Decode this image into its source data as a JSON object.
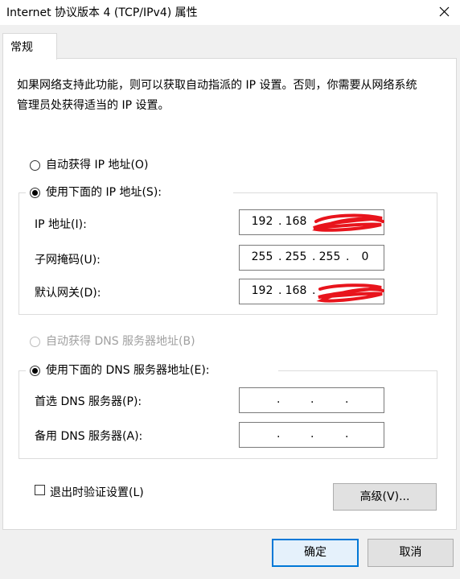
{
  "window": {
    "title": "Internet 协议版本 4 (TCP/IPv4) 属性",
    "close_glyph": "✕"
  },
  "tabs": [
    {
      "label": "常规"
    }
  ],
  "description": "如果网络支持此功能，则可以获取自动指派的 IP 设置。否则，你需要从网络系统管理员处获得适当的 IP 设置。",
  "ip": {
    "auto_label": "自动获得 IP 地址(O)",
    "manual_label": "使用下面的 IP 地址(S):",
    "auto_checked": false,
    "manual_checked": true,
    "fields": [
      {
        "label": "IP 地址(I):",
        "octets": [
          "192",
          "168",
          "",
          ""
        ],
        "redacted": true
      },
      {
        "label": "子网掩码(U):",
        "octets": [
          "255",
          "255",
          "255",
          "0"
        ],
        "redacted": false
      },
      {
        "label": "默认网关(D):",
        "octets": [
          "192",
          "168",
          "",
          ""
        ],
        "redacted": true
      }
    ]
  },
  "dns": {
    "auto_label": "自动获得 DNS 服务器地址(B)",
    "auto_disabled": true,
    "manual_label": "使用下面的 DNS 服务器地址(E):",
    "manual_checked": true,
    "fields": [
      {
        "label": "首选 DNS 服务器(P):",
        "octets": [
          "",
          "",
          "",
          ""
        ]
      },
      {
        "label": "备用 DNS 服务器(A):",
        "octets": [
          "",
          "",
          "",
          ""
        ]
      }
    ]
  },
  "validate_on_exit": {
    "label": "退出时验证设置(L)",
    "checked": false
  },
  "buttons": {
    "advanced": "高级(V)...",
    "ok": "确定",
    "cancel": "取消"
  },
  "colors": {
    "accent": "#0078d7",
    "redaction": "#e8141c"
  }
}
